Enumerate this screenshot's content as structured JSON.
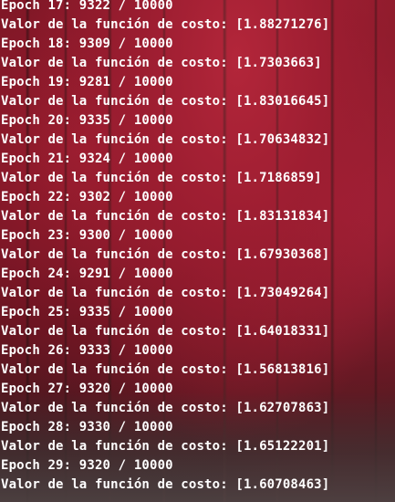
{
  "terminal": {
    "lines": [
      "Epoch 17: 9322 / 10000",
      "Valor de la función de costo: [1.88271276]",
      "Epoch 18: 9309 / 10000",
      "Valor de la función de costo: [1.7303663]",
      "Epoch 19: 9281 / 10000",
      "Valor de la función de costo: [1.83016645]",
      "Epoch 20: 9335 / 10000",
      "Valor de la función de costo: [1.70634832]",
      "Epoch 21: 9324 / 10000",
      "Valor de la función de costo: [1.7186859]",
      "Epoch 22: 9302 / 10000",
      "Valor de la función de costo: [1.83131834]",
      "Epoch 23: 9300 / 10000",
      "Valor de la función de costo: [1.67930368]",
      "Epoch 24: 9291 / 10000",
      "Valor de la función de costo: [1.73049264]",
      "Epoch 25: 9335 / 10000",
      "Valor de la función de costo: [1.64018331]",
      "Epoch 26: 9333 / 10000",
      "Valor de la función de costo: [1.56813816]",
      "Epoch 27: 9320 / 10000",
      "Valor de la función de costo: [1.62707863]",
      "Epoch 28: 9330 / 10000",
      "Valor de la función de costo: [1.65122201]",
      "Epoch 29: 9320 / 10000",
      "Valor de la función de costo: [1.60708463]"
    ]
  },
  "colors": {
    "text": "#ffffff",
    "background_accent": "#8f1d2c"
  }
}
